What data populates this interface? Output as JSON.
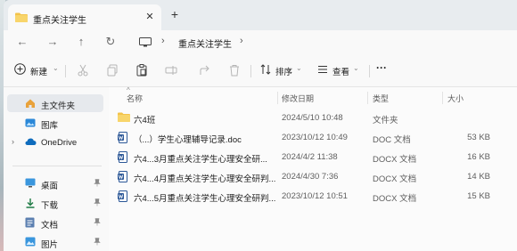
{
  "window": {
    "tab_title": "重点关注学生",
    "close_glyph": "✕",
    "new_tab_glyph": "+"
  },
  "nav": {
    "back_glyph": "←",
    "forward_glyph": "→",
    "up_glyph": "↑",
    "refresh_glyph": "↻",
    "separator": "›",
    "breadcrumb": "重点关注学生"
  },
  "toolbar": {
    "new_label": "新建",
    "sort_label": "排序",
    "view_label": "查看",
    "more_label": "···",
    "dropdown_glyph": "⌄"
  },
  "sidebar": {
    "items": [
      {
        "label": "主文件夹",
        "icon": "home-icon",
        "selected": true
      },
      {
        "label": "图库",
        "icon": "gallery-icon"
      },
      {
        "label": "OneDrive",
        "icon": "cloud-icon",
        "expandable": true
      },
      {
        "label": "桌面",
        "icon": "desktop-icon",
        "pinned": true
      },
      {
        "label": "下载",
        "icon": "download-icon",
        "pinned": true
      },
      {
        "label": "文档",
        "icon": "documents-icon",
        "pinned": true
      },
      {
        "label": "图片",
        "icon": "pictures-icon",
        "pinned": true
      }
    ],
    "expand_glyph": "›",
    "pin_glyph": "📌"
  },
  "columns": {
    "name": "名称",
    "modified": "修改日期",
    "type": "类型",
    "size": "大小",
    "sort_glyph": "^"
  },
  "files": [
    {
      "name": "六4班",
      "modified": "2024/5/10 10:48",
      "type": "文件夹",
      "size": "",
      "icon": "folder-icon"
    },
    {
      "name": "（...）学生心理辅导记录.doc",
      "modified": "2023/10/12 10:49",
      "type": "DOC 文档",
      "size": "53 KB",
      "icon": "word-doc-icon"
    },
    {
      "name": "六4...3月重点关注学生心理安全研...",
      "modified": "2024/4/2 11:38",
      "type": "DOCX 文档",
      "size": "16 KB",
      "icon": "word-doc-icon"
    },
    {
      "name": "六4...4月重点关注学生心理安全研判...",
      "modified": "2024/4/30 7:36",
      "type": "DOCX 文档",
      "size": "14 KB",
      "icon": "word-doc-icon"
    },
    {
      "name": "六4...5月重点关注学生心理安全研判...",
      "modified": "2023/10/12 10:51",
      "type": "DOCX 文档",
      "size": "15 KB",
      "icon": "word-doc-icon"
    }
  ],
  "colors": {
    "accent": "#0067c0",
    "folder": "#f3c34a",
    "word": "#2b5797"
  }
}
